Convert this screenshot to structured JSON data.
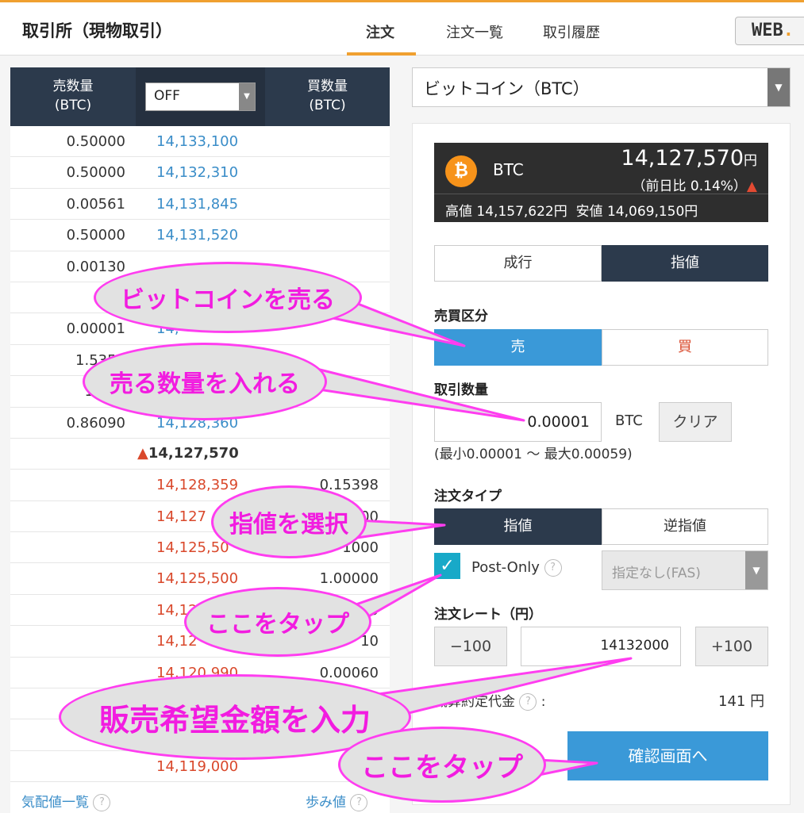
{
  "header": {
    "title": "取引所（現物取引）",
    "tabs": [
      "注文",
      "注文一覧",
      "取引履歴"
    ],
    "logo_main": "WEB",
    "logo_accent": "."
  },
  "orderbook": {
    "sell_qty_header": "売数量\n(BTC)",
    "buy_qty_header": "買数量\n(BTC)",
    "filter_value": "OFF",
    "asks": [
      {
        "qty": "0.50000",
        "price": "14,133,100"
      },
      {
        "qty": "0.50000",
        "price": "14,132,310"
      },
      {
        "qty": "0.00561",
        "price": "14,131,845"
      },
      {
        "qty": "0.50000",
        "price": "14,131,520"
      },
      {
        "qty": "0.00130",
        "price": ""
      },
      {
        "qty": "0.50",
        "price": ""
      },
      {
        "qty": "0.00001",
        "price": "14,"
      },
      {
        "qty": "1.5354",
        "price": ""
      },
      {
        "qty": "1.574",
        "price": ""
      },
      {
        "qty": "0.86090",
        "price": "14,128,360"
      }
    ],
    "last_price": "14,127,570",
    "last_price_arrow": "▲",
    "bids": [
      {
        "price": "14,128,359",
        "qty": "0.15398"
      },
      {
        "price": "14,127",
        "qty": "00"
      },
      {
        "price": "14,125,50",
        "qty": "1000"
      },
      {
        "price": "14,125,500",
        "qty": "1.00000"
      },
      {
        "price": "14,12",
        "qty": "00"
      },
      {
        "price": "14,12",
        "qty": "10"
      },
      {
        "price": "14,120,990",
        "qty": "0.00060"
      },
      {
        "price": "",
        "qty": ""
      },
      {
        "price": "",
        "qty": ""
      },
      {
        "price": "14,119,000",
        "qty": "0.0"
      }
    ],
    "footer_left": "気配値一覧",
    "footer_right": "歩み値"
  },
  "order": {
    "pair": "ビットコイン（BTC）",
    "ticker": {
      "coin_symbol": "₿",
      "coin": "BTC",
      "price": "14,127,570",
      "price_unit": "円",
      "change": "（前日比 0.14%）",
      "change_arrow": "▲",
      "high": "高値 14,157,622円",
      "low": "安値 14,069,150円"
    },
    "order_kind": [
      "成行",
      "指値"
    ],
    "side_label": "売買区分",
    "side_options": [
      "売",
      "買"
    ],
    "qty_label": "取引数量",
    "qty_value": "0.00001",
    "qty_unit": "BTC",
    "clear_label": "クリア",
    "qty_range": "(最小0.00001 〜 最大0.00059)",
    "type_label": "注文タイプ",
    "type_options": [
      "指値",
      "逆指値"
    ],
    "post_only": "Post-Only",
    "post_only_checked": true,
    "fas_value": "指定なし(FAS)",
    "rate_label": "注文レート（円）",
    "minus_label": "−100",
    "rate_value": "14132000",
    "plus_label": "+100",
    "estimate_label": "概算約定代金",
    "estimate_value": "141 円",
    "confirm_label": "確認画面へ"
  },
  "annotations": {
    "sell": "ビットコインを売る",
    "qty": "売る数量を入れる",
    "limit": "指値を選択",
    "tap1": "ここをタップ",
    "price": "販売希望金額を入力",
    "tap2": "ここをタップ"
  },
  "colors": {
    "accent": "#f0a030",
    "navy": "#2c3a4c",
    "blue": "#3a99d8",
    "ask_blue": "#3a8dc8",
    "bid_red": "#d9482b",
    "annotation_pink": "#ff3df0"
  }
}
